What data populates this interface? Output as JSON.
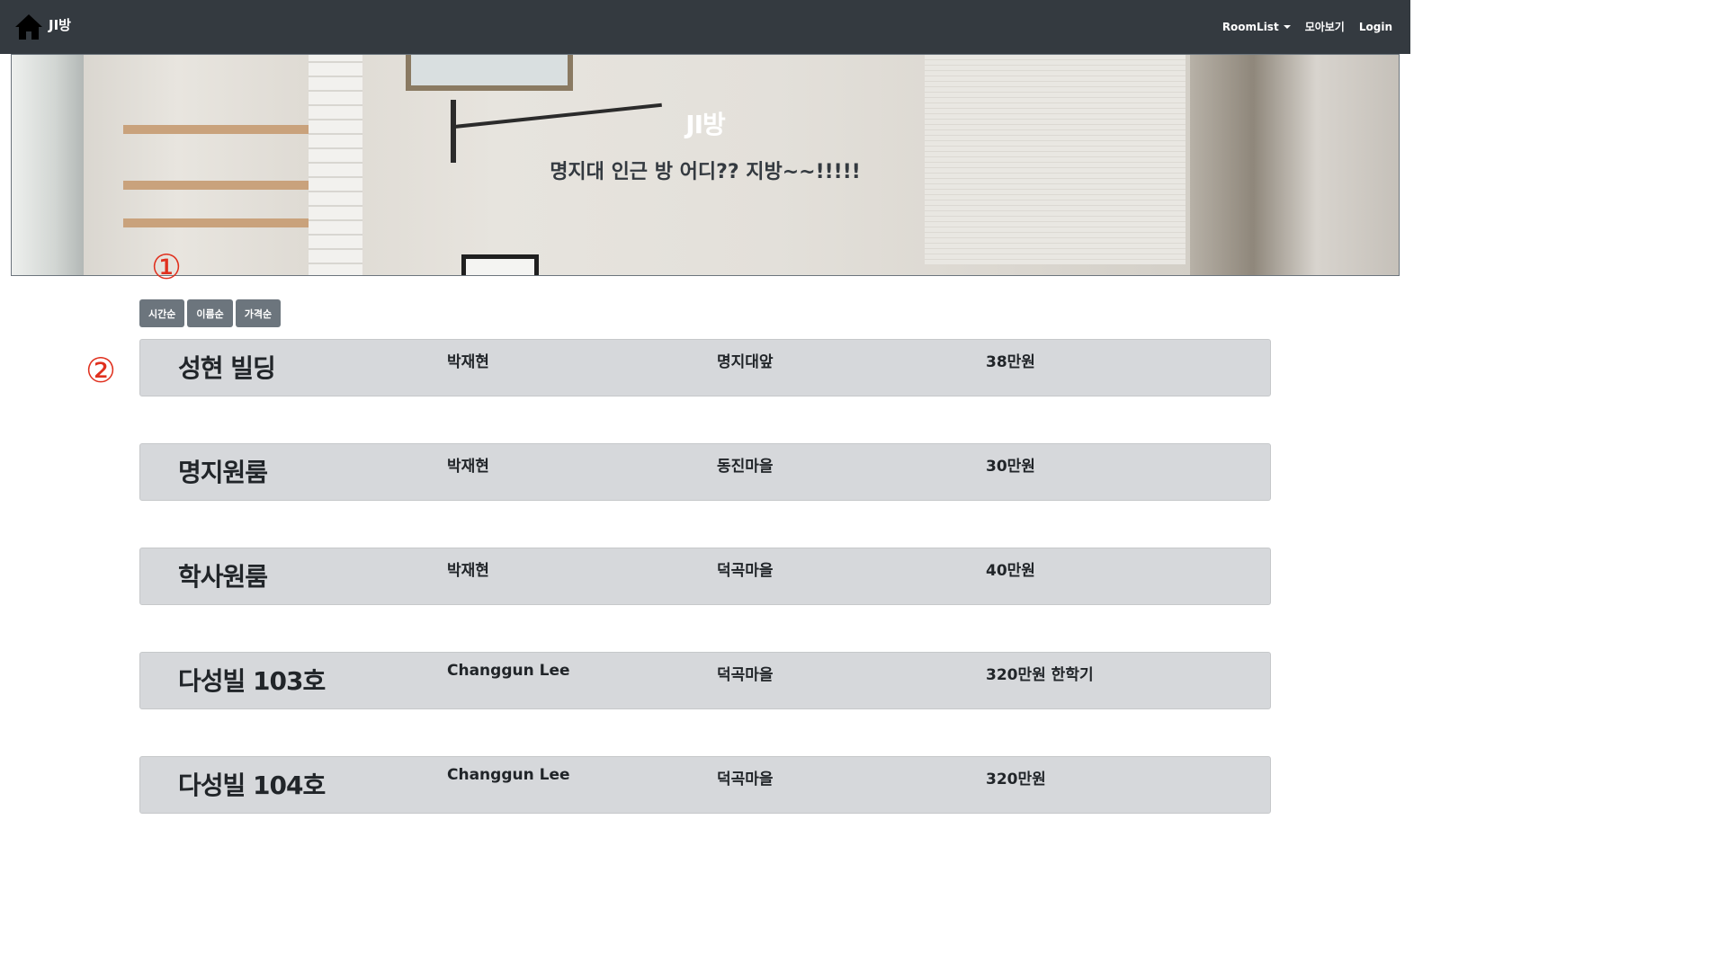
{
  "navbar": {
    "brand": "JI방",
    "home_icon": "home-icon",
    "links": [
      {
        "label": "RoomList",
        "dropdown": true
      },
      {
        "label": "모아보기",
        "dropdown": false
      },
      {
        "label": "Login",
        "dropdown": false
      }
    ]
  },
  "hero": {
    "title": "JI방",
    "subtitle": "명지대 인근 방 어디?? 지방~~!!!!!"
  },
  "annotations": [
    "①",
    "②"
  ],
  "sort_buttons": [
    "시간순",
    "이름순",
    "가격순"
  ],
  "rooms": [
    {
      "name": "성현 빌딩",
      "owner": "박재현",
      "location": "명지대앞",
      "price": "38만원"
    },
    {
      "name": "명지원룸",
      "owner": "박재현",
      "location": "동진마을",
      "price": "30만원"
    },
    {
      "name": "학사원룸",
      "owner": "박재현",
      "location": "덕곡마을",
      "price": "40만원"
    },
    {
      "name": "다성빌 103호",
      "owner": "Changgun Lee",
      "location": "덕곡마을",
      "price": "320만원 한학기"
    },
    {
      "name": "다성빌 104호",
      "owner": "Changgun Lee",
      "location": "덕곡마을",
      "price": "320만원"
    }
  ],
  "colors": {
    "navbar": "#343a40",
    "sort_button": "#6c757d",
    "room_bg": "#d6d8db",
    "annotation": "#e0301e"
  }
}
